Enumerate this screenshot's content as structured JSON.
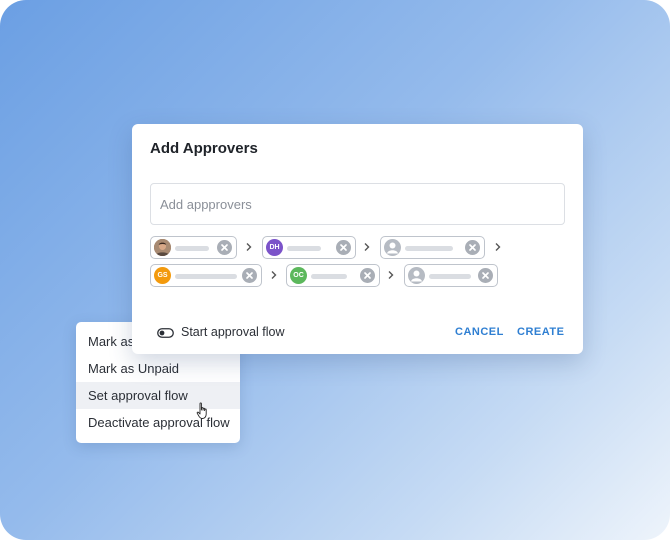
{
  "dialog": {
    "title": "Add Approvers",
    "input_placeholder": "Add appprovers",
    "approvers": [
      {
        "initials": "",
        "avatar_type": "photo"
      },
      {
        "initials": "DH",
        "avatar_color": "#7b53c9"
      },
      {
        "initials": "",
        "avatar_type": "placeholder"
      },
      {
        "initials": "GS",
        "avatar_color": "#f39a0d"
      },
      {
        "initials": "OC",
        "avatar_color": "#5cb85c"
      },
      {
        "initials": "",
        "avatar_type": "placeholder"
      }
    ],
    "toggle_label": "Start approval flow",
    "cancel_label": "CANCEL",
    "create_label": "CREATE"
  },
  "context_menu": {
    "items": [
      {
        "label": "Mark as Paid"
      },
      {
        "label": "Mark as Unpaid"
      },
      {
        "label": "Set approval flow"
      },
      {
        "label": "Deactivate approval flow"
      }
    ],
    "hovered_item": "Set approval flow"
  },
  "colors": {
    "accent": "#2f7fd2",
    "chip_border": "#bfc4cc",
    "remove_icon_bg": "#a9aeb6"
  },
  "icons": [
    "remove-icon",
    "chevron-right-icon",
    "toggle-icon",
    "user-placeholder-icon",
    "pointer-cursor-icon"
  ]
}
